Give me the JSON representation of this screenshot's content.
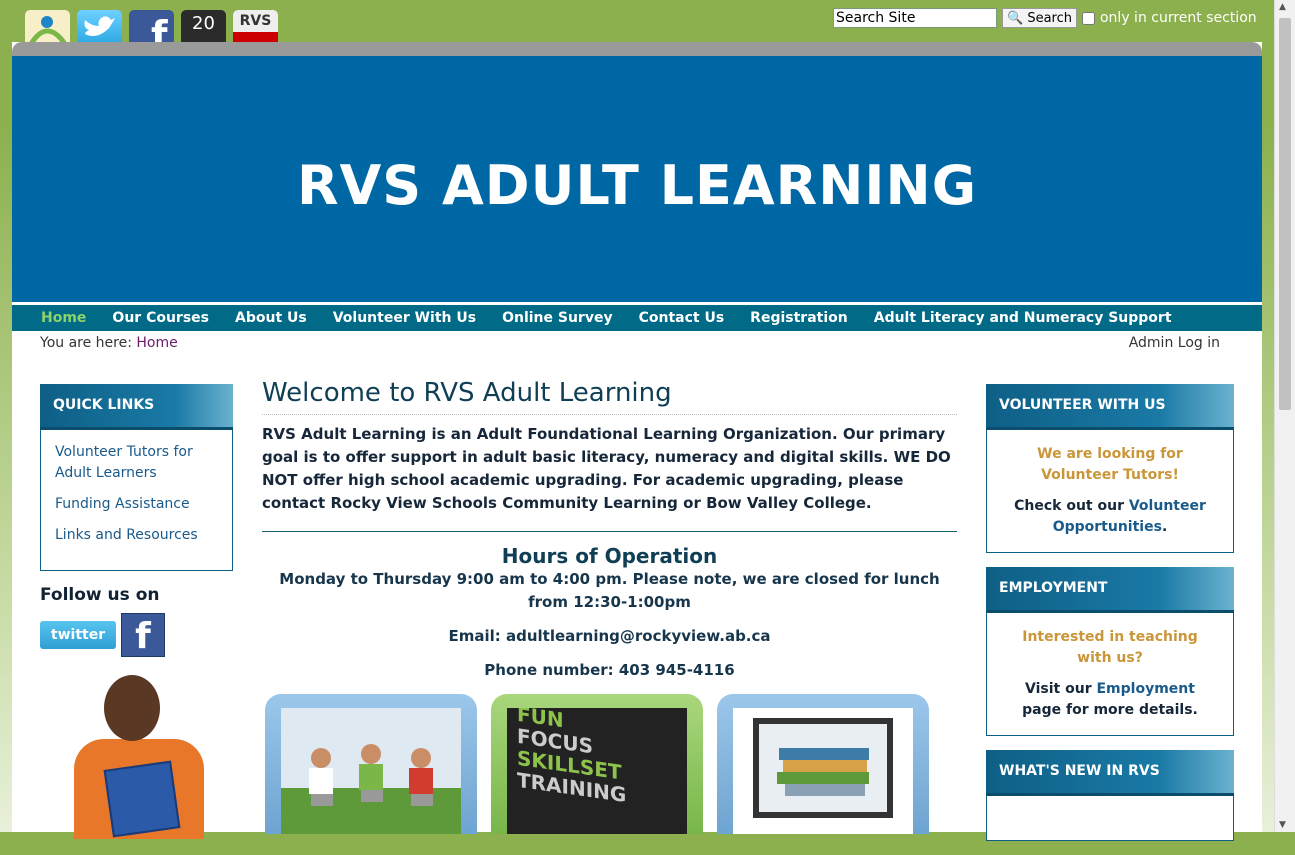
{
  "top": {
    "social_icons": [
      "rvs-logo-icon",
      "twitter-icon",
      "facebook-icon",
      "2022-icon",
      "rvs-tube-icon"
    ],
    "icon_20": "20",
    "icon_tube": "RVS",
    "search_placeholder": "Search Site",
    "search_button": "🔍 Search",
    "checkbox_label": "only in current section"
  },
  "banner": {
    "title": "RVS ADULT LEARNING"
  },
  "nav": {
    "items": [
      "Home",
      "Our Courses",
      "About Us",
      "Volunteer With Us",
      "Online Survey",
      "Contact Us",
      "Registration",
      "Adult Literacy and Numeracy Support"
    ]
  },
  "breadcrumb": {
    "prefix": "You are here:",
    "home": "Home",
    "admin": "Admin Log in"
  },
  "left": {
    "quick_links_title": "QUICK LINKS",
    "links": [
      "Volunteer Tutors for Adult Learners",
      "Funding Assistance",
      "Links and Resources"
    ],
    "follow": "Follow us on",
    "twitter_btn": "twitter",
    "facebook_btn": "f"
  },
  "main": {
    "title": "Welcome to RVS Adult Learning",
    "intro": "RVS Adult Learning is an Adult Foundational Learning Organization. Our primary goal is to offer support in adult basic literacy, numeracy and digital skills. WE DO NOT offer high school academic upgrading. For academic upgrading, please contact Rocky View Schools Community Learning or Bow Valley College.",
    "hours_title": "Hours of Operation",
    "hours_text": "Monday to Thursday 9:00 am to 4:00 pm. Please note, we are closed for lunch from 12:30-1:00pm",
    "email": "Email: adultlearning@rockyview.ab.ca",
    "phone": "Phone number: 403 945-4116",
    "tile2_text": [
      "FUN",
      "FOCUS",
      "SKILLSET",
      "TRAINING"
    ]
  },
  "right": {
    "volunteer": {
      "title": "VOLUNTEER WITH US",
      "highlight": "We are looking for Volunteer Tutors!",
      "pre": "Check out our ",
      "link": "Volunteer Opportunities",
      "post": "."
    },
    "employment": {
      "title": "EMPLOYMENT",
      "highlight": "Interested in teaching with us?",
      "pre": "Visit our ",
      "link": "Employment",
      "post": " page for more details."
    },
    "whats_new": {
      "title": "WHAT'S NEW IN RVS"
    }
  }
}
